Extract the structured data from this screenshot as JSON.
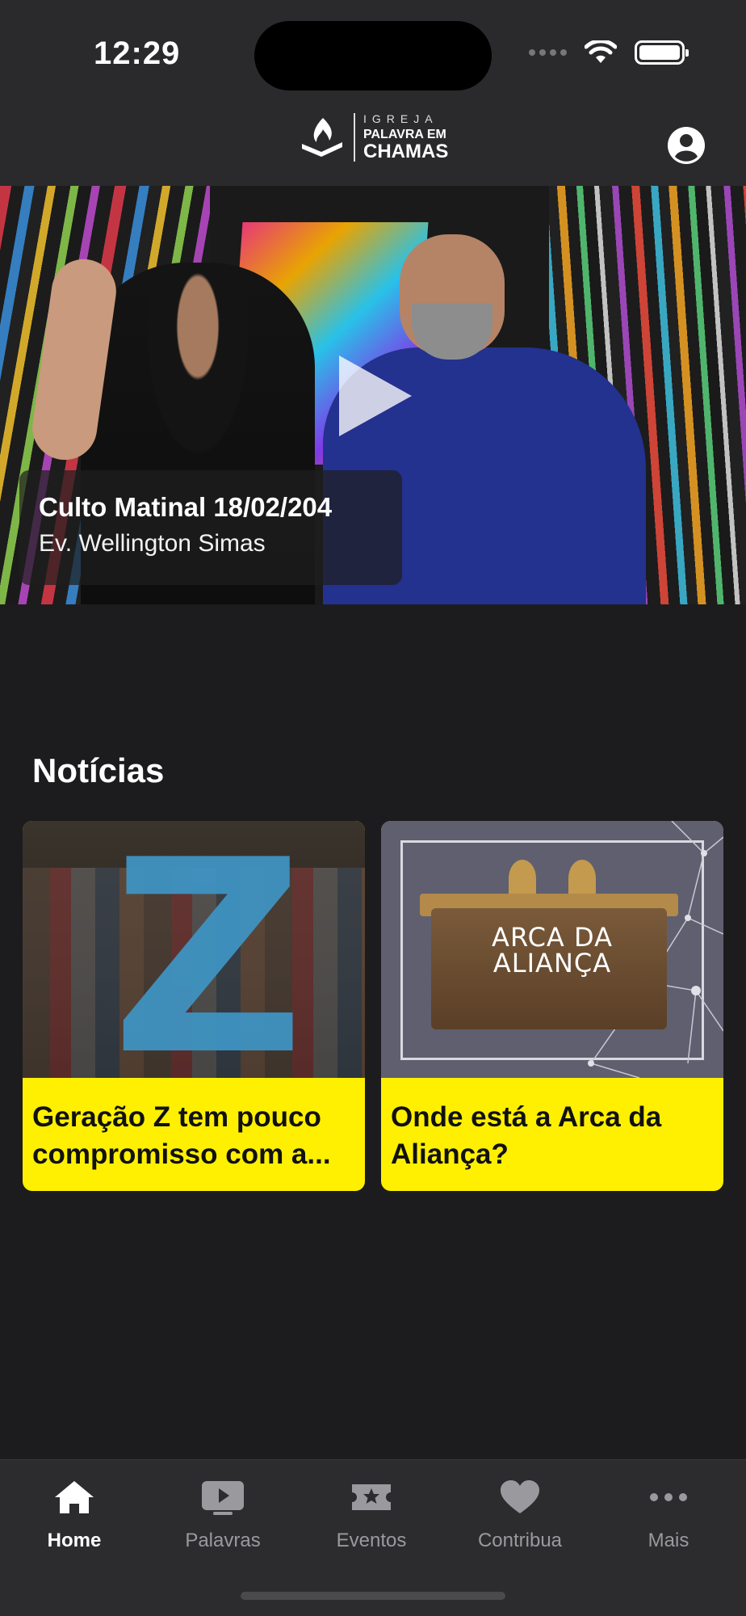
{
  "status_bar": {
    "time": "12:29"
  },
  "header": {
    "logo_line1": "IGREJA",
    "logo_line2": "PALAVRA EM",
    "logo_line3": "CHAMAS",
    "profile_icon": "user-circle-icon"
  },
  "hero": {
    "title": "Culto Matinal 18/02/204",
    "subtitle": "Ev. Wellington Simas",
    "play_icon": "play-icon"
  },
  "news": {
    "section_title": "Notícias",
    "items": [
      {
        "title": "Geração Z tem pouco compromisso com a..."
      },
      {
        "title": "Onde está a Arca da Aliança?",
        "image_text_1": "ARCA DA",
        "image_text_2": "ALIANÇA"
      }
    ]
  },
  "tabs": [
    {
      "label": "Home",
      "icon": "home-icon",
      "active": true
    },
    {
      "label": "Palavras",
      "icon": "video-play-icon",
      "active": false
    },
    {
      "label": "Eventos",
      "icon": "ticket-star-icon",
      "active": false
    },
    {
      "label": "Contribua",
      "icon": "heart-icon",
      "active": false
    },
    {
      "label": "Mais",
      "icon": "more-dots-icon",
      "active": false
    }
  ],
  "colors": {
    "background": "#1c1c1e",
    "bar": "#2c2c2e",
    "accent_yellow": "#fef000"
  }
}
